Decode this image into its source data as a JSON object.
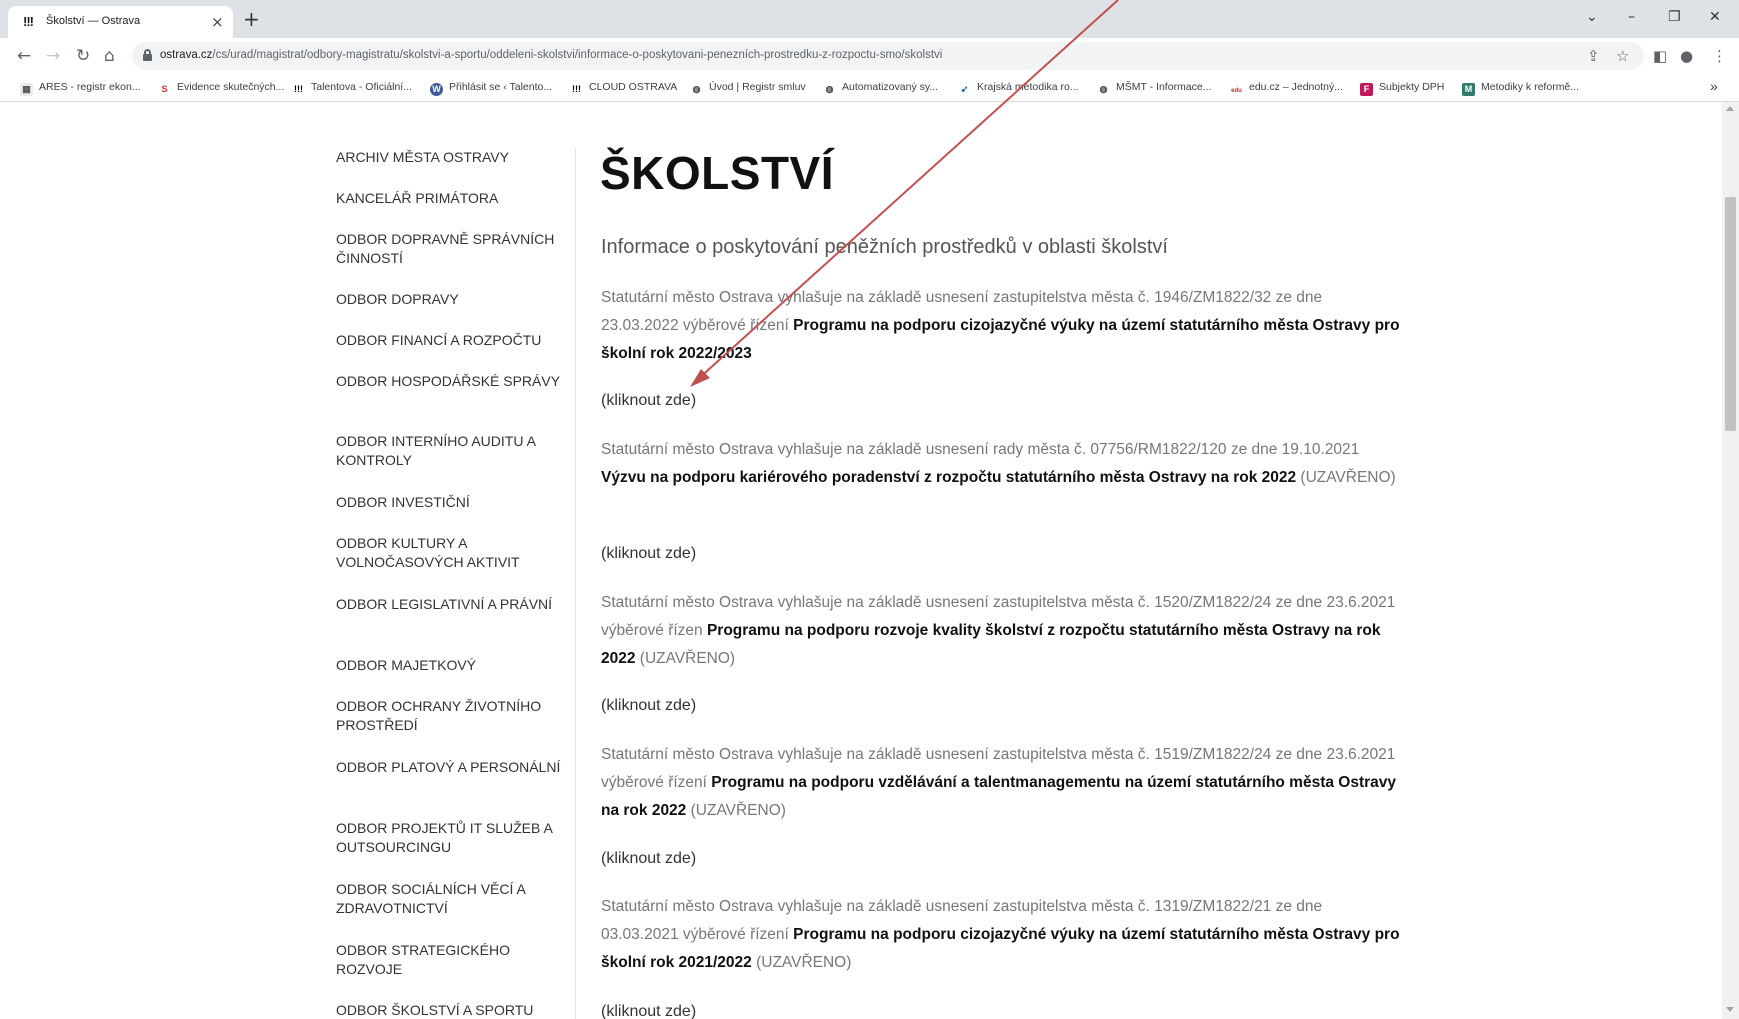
{
  "browser": {
    "tab_title": "Školství — Ostrava",
    "tab_favicon": "!!!",
    "url_host": "ostrava.cz",
    "url_path": "/cs/urad/magistrat/odbory-magistratu/skolstvi-a-sportu/oddeleni-skolstvi/informace-o-poskytovani-penezních-prostredku-z-rozpoctu-smo/skolstvi",
    "bookmarks": [
      {
        "label": "ARES - registr ekon...",
        "icon": "ares-icon"
      },
      {
        "label": "Evidence skutečných...",
        "icon": "s-icon"
      },
      {
        "label": "Talentova - Oficiální...",
        "icon": "ostrava-icon"
      },
      {
        "label": "Přihlásit se ‹ Talento...",
        "icon": "wordpress-icon"
      },
      {
        "label": "CLOUD OSTRAVA",
        "icon": "ostrava-icon"
      },
      {
        "label": "Úvod | Registr smluv",
        "icon": "globe-icon"
      },
      {
        "label": "Automatizovaný sy...",
        "icon": "globe-icon"
      },
      {
        "label": "Krajská metodika ro...",
        "icon": "krajska-icon"
      },
      {
        "label": "MŠMT - Informace...",
        "icon": "globe-icon"
      },
      {
        "label": "edu.cz – Jednotný...",
        "icon": "edu-icon"
      },
      {
        "label": "Subjekty DPH",
        "icon": "f-icon"
      },
      {
        "label": "Metodiky k reformě...",
        "icon": "m-icon"
      }
    ],
    "bookmarks_more": "»"
  },
  "sidebar": {
    "items": [
      "ARCHIV MĚSTA OSTRAVY",
      "KANCELÁŘ PRIMÁTORA",
      "ODBOR DOPRAVNĚ SPRÁVNÍCH ČINNOSTÍ",
      "ODBOR DOPRAVY",
      "ODBOR FINANCÍ A ROZPOČTU",
      "ODBOR HOSPODÁŘSKÉ SPRÁVY",
      "ODBOR INTERNÍHO AUDITU A KONTROLY",
      "ODBOR INVESTIČNÍ",
      "ODBOR KULTURY A VOLNOČASOVÝCH AKTIVIT",
      "ODBOR LEGISLATIVNÍ A PRÁVNÍ",
      "ODBOR MAJETKOVÝ",
      "ODBOR OCHRANY ŽIVOTNÍHO PROSTŘEDÍ",
      "ODBOR PLATOVÝ A PERSONÁLNÍ",
      "ODBOR PROJEKTŮ IT SLUŽEB A OUTSOURCINGU",
      "ODBOR SOCIÁLNÍCH VĚCÍ A ZDRAVOTNICTVÍ",
      "ODBOR STRATEGICKÉHO ROZVOJE",
      "ODBOR ŠKOLSTVÍ A SPORTU"
    ]
  },
  "main": {
    "title": "ŠKOLSTVÍ",
    "subtitle": "Informace o poskytování peněžních prostředků v oblasti školství",
    "link_label": "(kliknout zde)",
    "entries": [
      {
        "intro": "Statutární město Ostrava vyhlašuje na základě usnesení zastupitelstva města č. 1946/ZM1822/32 ze dne 23.03.2022 výběrové řízení ",
        "program": "Programu na podporu cizojazyčné výuky na území statutárního města Ostravy pro školní rok 2022/2023",
        "status": ""
      },
      {
        "intro": "Statutární město Ostrava vyhlašuje na základě usnesení rady města č. 07756/RM1822/120 ze dne 19.10.2021 ",
        "program": "Výzvu na podporu kariérového poradenství z rozpočtu statutárního města Ostravy na rok 2022",
        "status": " (UZAVŘENO)"
      },
      {
        "intro": "Statutární město Ostrava vyhlašuje na základě usnesení zastupitelstva města č. 1520/ZM1822/24 ze dne 23.6.2021  výběrové řízen ",
        "program": "Programu na podporu rozvoje kvality školství z rozpočtu statutárního města Ostravy na rok 2022",
        "status": " (UZAVŘENO)"
      },
      {
        "intro": "Statutární město Ostrava vyhlašuje na základě usnesení zastupitelstva města č. 1519/ZM1822/24 ze dne 23.6.2021  výběrové řízení ",
        "program": "Programu na podporu vzdělávání a talentmanagementu na území statutárního města Ostravy na rok 2022",
        "status": " (UZAVŘENO)"
      },
      {
        "intro": "Statutární město Ostrava vyhlašuje na základě usnesení zastupitelstva města č. 1319/ZM1822/21 ze dne 03.03.2021 výběrové řízení ",
        "program": "Programu na podporu cizojazyčné výuky na území statutárního města Ostravy pro školní rok 2021/2022",
        "status": " (UZAVŘENO)"
      }
    ]
  },
  "annotation": {
    "arrow_color": "#c0504d"
  }
}
